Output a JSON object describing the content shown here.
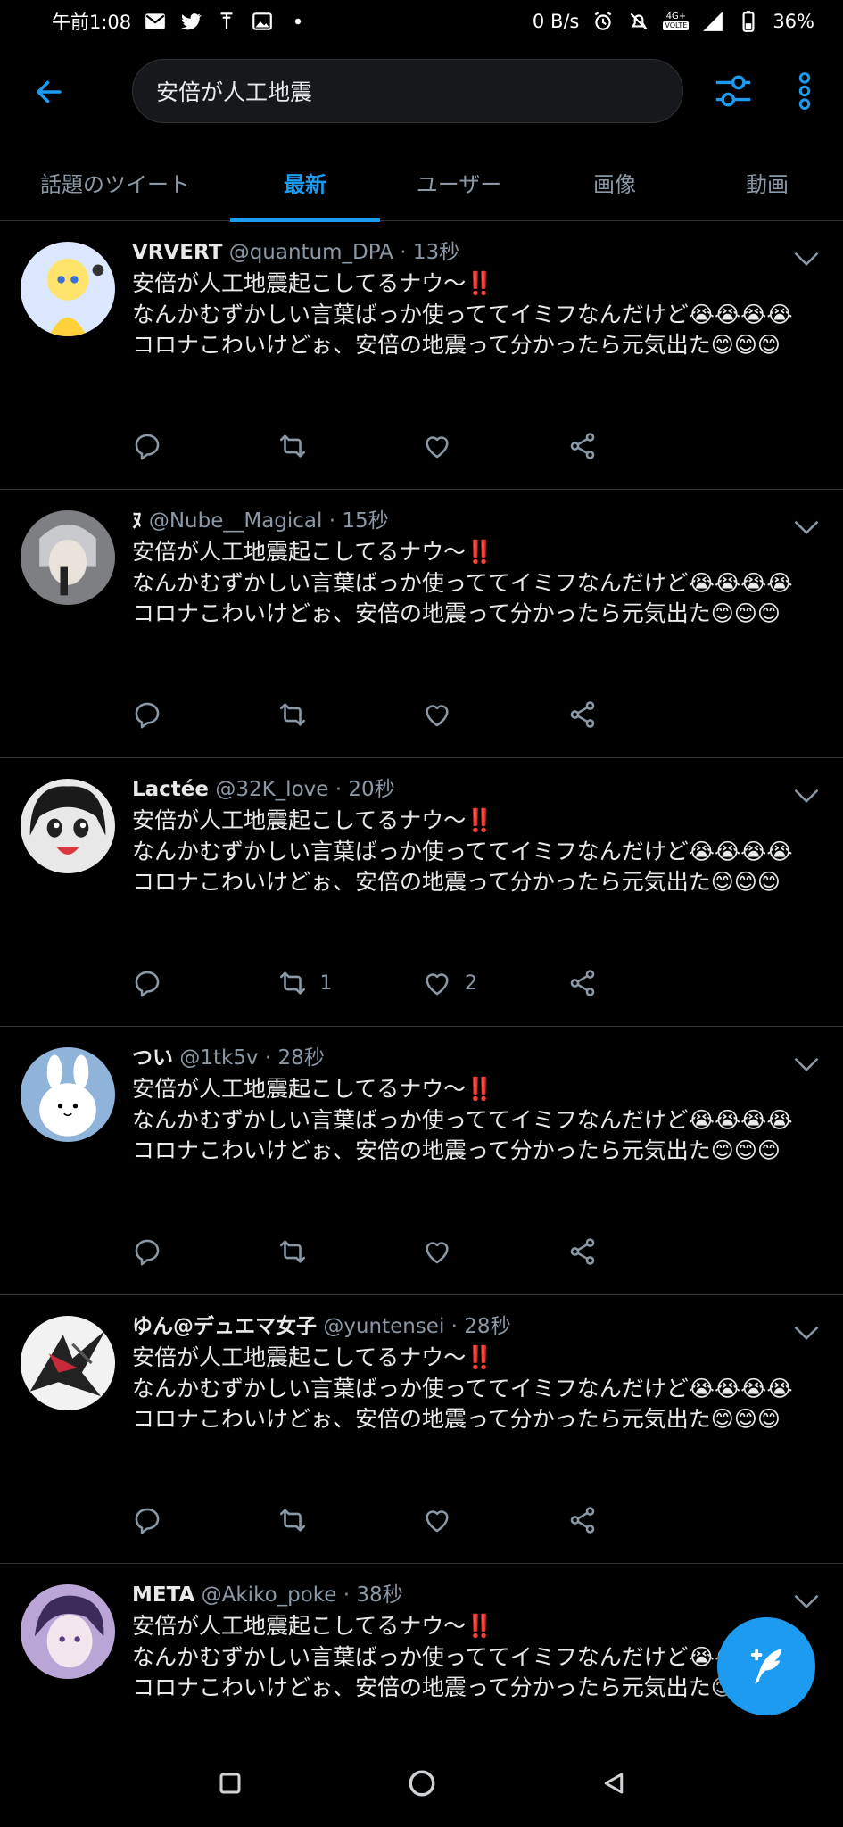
{
  "status_bar": {
    "time": "午前1:08",
    "net_speed": "0 B/s",
    "network_badge_top": "4G+",
    "network_badge_bottom": "VOLTE",
    "battery": "36%"
  },
  "search": {
    "query": "安倍が人工地震"
  },
  "tabs": [
    {
      "label": "話題のツイート",
      "active": false
    },
    {
      "label": "最新",
      "active": true
    },
    {
      "label": "ユーザー",
      "active": false
    },
    {
      "label": "画像",
      "active": false
    },
    {
      "label": "動画",
      "active": false
    }
  ],
  "tweet_text": {
    "line1": "安倍が人工地震起こしてるナウ〜‼️",
    "line2": "なんかむずかしい言葉ばっか使っててイミフなんだけど😭😭😭😭",
    "line3": "コロナこわいけどぉ、安倍の地震って分かったら元気出た😊😊😊"
  },
  "tweets": [
    {
      "name": "VRVERT",
      "handle": "@quantum_DPA",
      "sep": " · ",
      "time": "13秒",
      "retweets": "",
      "likes": ""
    },
    {
      "name": "ﾇ",
      "handle": "@Nube__Magical",
      "sep": " · ",
      "time": "15秒",
      "retweets": "",
      "likes": ""
    },
    {
      "name": "Lactée",
      "handle": "@32K_love",
      "sep": " · ",
      "time": "20秒",
      "retweets": "1",
      "likes": "2"
    },
    {
      "name": "つい",
      "handle": "@1tk5v",
      "sep": " · ",
      "time": "28秒",
      "retweets": "",
      "likes": ""
    },
    {
      "name": "ゆん@デュエマ女子",
      "handle": "@yuntensei",
      "sep": " · ",
      "time": "28秒",
      "retweets": "",
      "likes": ""
    },
    {
      "name": "META",
      "handle": "@Akiko_poke",
      "sep": " · ",
      "time": "38秒",
      "retweets": "",
      "likes": ""
    }
  ],
  "colors": {
    "accent": "#1d9bf0",
    "background": "#000000",
    "secondary_text": "#8b98a5",
    "divider": "#2f3336"
  },
  "icons": {
    "back": "arrow-left-icon",
    "filter": "filter-sliders-icon",
    "more": "more-vertical-icon",
    "reply": "reply-icon",
    "retweet": "retweet-icon",
    "like": "heart-icon",
    "share": "share-icon",
    "compose": "compose-tweet-icon",
    "nav_recents": "square-icon",
    "nav_home": "circle-icon",
    "nav_back": "triangle-back-icon"
  }
}
